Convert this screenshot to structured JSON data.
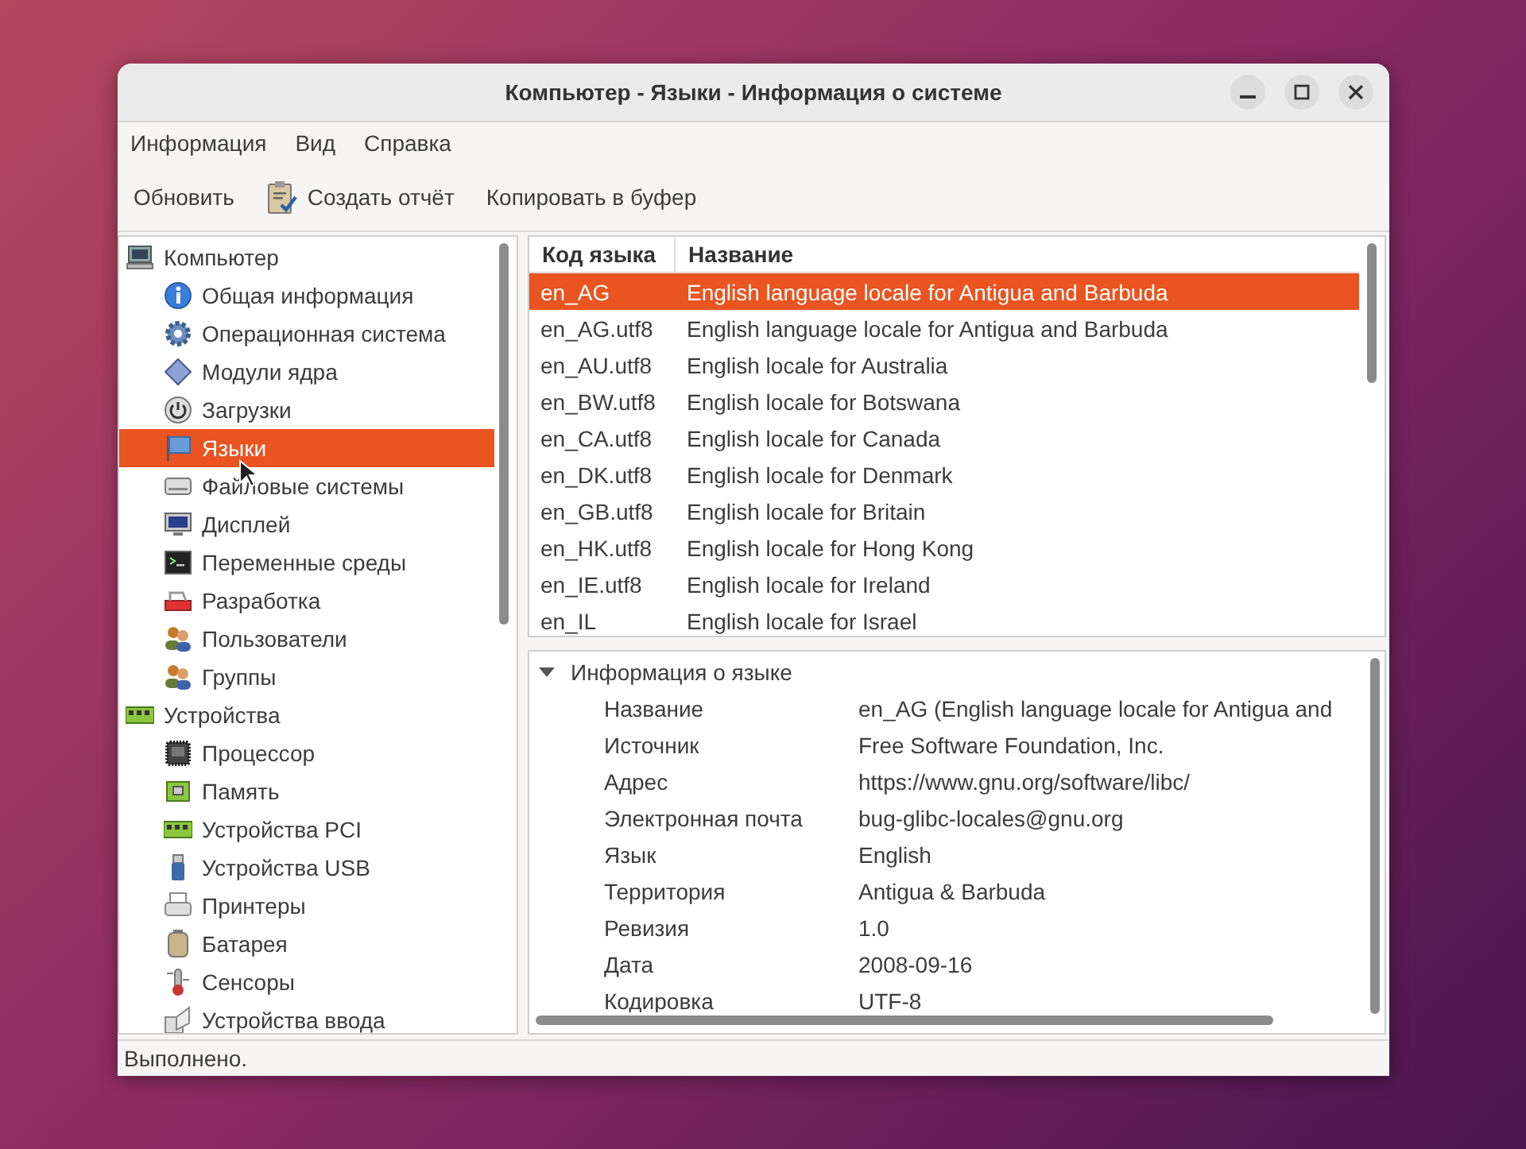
{
  "window": {
    "title": "Компьютер - Языки - Информация о системе"
  },
  "menu": [
    "Информация",
    "Вид",
    "Справка"
  ],
  "toolbar": [
    {
      "label": "Обновить",
      "kind": "plain"
    },
    {
      "label": "Создать отчёт",
      "kind": "icon"
    },
    {
      "label": "Копировать в буфер",
      "kind": "plain"
    }
  ],
  "sidebar": {
    "items": [
      {
        "label": "Компьютер",
        "selected": false,
        "children": [
          {
            "label": "Общая информация",
            "selected": false
          },
          {
            "label": "Операционная система",
            "selected": false
          },
          {
            "label": "Модули ядра",
            "selected": false
          },
          {
            "label": "Загрузки",
            "selected": false
          },
          {
            "label": "Языки",
            "selected": true
          },
          {
            "label": "Файловые системы",
            "selected": false
          },
          {
            "label": "Дисплей",
            "selected": false
          },
          {
            "label": "Переменные среды",
            "selected": false
          },
          {
            "label": "Разработка",
            "selected": false
          },
          {
            "label": "Пользователи",
            "selected": false
          },
          {
            "label": "Группы",
            "selected": false
          }
        ]
      },
      {
        "label": "Устройства",
        "selected": false,
        "children": [
          {
            "label": "Процессор",
            "selected": false
          },
          {
            "label": "Память",
            "selected": false
          },
          {
            "label": "Устройства PCI",
            "selected": false
          },
          {
            "label": "Устройства USB",
            "selected": false
          },
          {
            "label": "Принтеры",
            "selected": false
          },
          {
            "label": "Батарея",
            "selected": false
          },
          {
            "label": "Сенсоры",
            "selected": false
          },
          {
            "label": "Устройства ввода",
            "selected": false
          }
        ]
      }
    ]
  },
  "table": {
    "columns": [
      "Код языка",
      "Название"
    ],
    "rows": [
      {
        "cells": [
          "en_AG",
          "English language locale for Antigua and Barbuda"
        ],
        "selected": true
      },
      {
        "cells": [
          "en_AG.utf8",
          "English language locale for Antigua and Barbuda"
        ],
        "selected": false
      },
      {
        "cells": [
          "en_AU.utf8",
          "English locale for Australia"
        ],
        "selected": false
      },
      {
        "cells": [
          "en_BW.utf8",
          "English locale for Botswana"
        ],
        "selected": false
      },
      {
        "cells": [
          "en_CA.utf8",
          "English locale for Canada"
        ],
        "selected": false
      },
      {
        "cells": [
          "en_DK.utf8",
          "English locale for Denmark"
        ],
        "selected": false
      },
      {
        "cells": [
          "en_GB.utf8",
          "English locale for Britain"
        ],
        "selected": false
      },
      {
        "cells": [
          "en_HK.utf8",
          "English locale for Hong Kong"
        ],
        "selected": false
      },
      {
        "cells": [
          "en_IE.utf8",
          "English locale for Ireland"
        ],
        "selected": false
      },
      {
        "cells": [
          "en_IL",
          "English locale for Israel"
        ],
        "selected": false
      }
    ]
  },
  "details": {
    "title": "Информация о языке",
    "expanded": true,
    "fields": [
      {
        "label": "Название",
        "value": "en_AG (English language locale for Antigua and"
      },
      {
        "label": "Источник",
        "value": "Free Software Foundation, Inc."
      },
      {
        "label": "Адрес",
        "value": "https://www.gnu.org/software/libc/"
      },
      {
        "label": "Электронная почта",
        "value": "bug-glibc-locales@gnu.org"
      },
      {
        "label": "Язык",
        "value": "English"
      },
      {
        "label": "Территория",
        "value": "Antigua & Barbuda"
      },
      {
        "label": "Ревизия",
        "value": "1.0"
      },
      {
        "label": "Дата",
        "value": "2008-09-16"
      },
      {
        "label": "Кодировка",
        "value": "UTF-8"
      }
    ]
  },
  "status_bar": "Выполнено."
}
